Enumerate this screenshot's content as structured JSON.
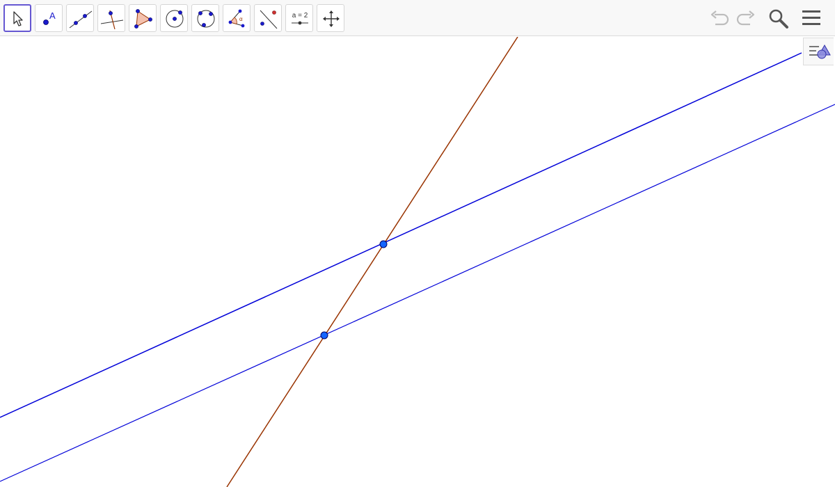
{
  "toolbar": {
    "tools": [
      {
        "name": "move-tool",
        "icon": "pointer-arrow-icon",
        "selected": true
      },
      {
        "name": "point-tool",
        "icon": "point-with-label-icon",
        "label": "A"
      },
      {
        "name": "line-tool",
        "icon": "line-through-two-points-icon"
      },
      {
        "name": "perpendicular-line-tool",
        "icon": "perpendicular-line-icon"
      },
      {
        "name": "polygon-tool",
        "icon": "polygon-icon"
      },
      {
        "name": "circle-tool",
        "icon": "circle-center-point-icon"
      },
      {
        "name": "circle-three-points-tool",
        "icon": "circle-through-three-points-icon"
      },
      {
        "name": "angle-tool",
        "icon": "angle-icon",
        "label": "α"
      },
      {
        "name": "reflect-tool",
        "icon": "reflect-about-line-icon"
      },
      {
        "name": "slider-tool",
        "icon": "slider-icon",
        "label": "a = 2"
      },
      {
        "name": "move-graphics-view-tool",
        "icon": "move-arrows-icon"
      }
    ],
    "right": [
      {
        "name": "undo-button",
        "icon": "undo-icon"
      },
      {
        "name": "redo-button",
        "icon": "redo-icon"
      },
      {
        "name": "search-button",
        "icon": "search-icon"
      },
      {
        "name": "menu-button",
        "icon": "hamburger-menu-icon"
      }
    ]
  },
  "algebra_toggle": {
    "icon": "algebra-view-toggle-icon"
  },
  "colors": {
    "accent": "#6557d2",
    "line_blue": "#0000d8",
    "line_brown": "#993300",
    "point_fill": "#1565ff",
    "point_stroke": "#000066",
    "icon_blue": "#1a1acc",
    "polygon_fill": "#f4c1ae"
  },
  "construction": {
    "lines": [
      {
        "name": "upper-blue-line",
        "color": "#0000d8"
      },
      {
        "name": "lower-blue-line",
        "color": "#0000d8"
      },
      {
        "name": "transversal-line",
        "color": "#993300"
      }
    ],
    "points": [
      {
        "name": "upper-intersection-point"
      },
      {
        "name": "lower-intersection-point"
      }
    ]
  }
}
